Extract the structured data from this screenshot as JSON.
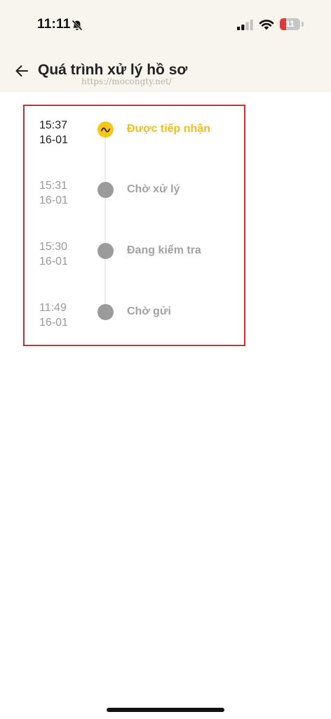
{
  "status_bar": {
    "time": "11:11",
    "battery_level": "11",
    "icons": [
      "bell-muted-icon",
      "signal-icon",
      "wifi-icon",
      "battery-icon"
    ]
  },
  "header": {
    "back_icon": "arrow-left-icon",
    "title": "Quá trình xử lý hồ sơ"
  },
  "watermark": "https://mocongty.net/",
  "timeline": {
    "steps": [
      {
        "time": "15:37",
        "date": "16-01",
        "label": "Được tiếp nhận",
        "active": true
      },
      {
        "time": "15:31",
        "date": "16-01",
        "label": "Chờ xử lý",
        "active": false
      },
      {
        "time": "15:30",
        "date": "16-01",
        "label": "Đang kiểm tra",
        "active": false
      },
      {
        "time": "11:49",
        "date": "16-01",
        "label": "Chờ gửi",
        "active": false
      }
    ]
  },
  "colors": {
    "active": "#f2be1d",
    "inactive": "#9b9b9b",
    "highlight_border": "#d62b33",
    "header_bg": "#f8f5ef"
  }
}
